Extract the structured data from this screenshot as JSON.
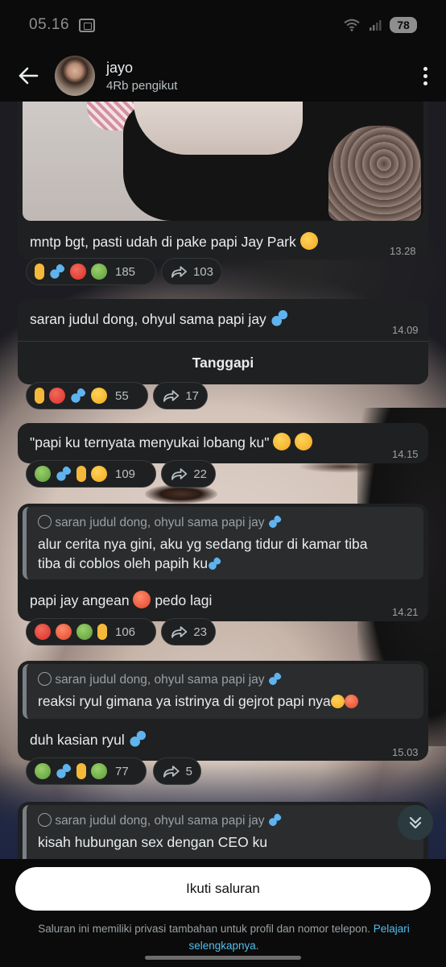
{
  "status_bar": {
    "time": "05.16",
    "battery": "78"
  },
  "header": {
    "channel_name": "jayo",
    "followers": "4Rb pengikut"
  },
  "messages": [
    {
      "text": "mntp bgt, pasti udah di pake papi Jay Park",
      "time": "13.28",
      "reaction_count": "185",
      "forward_count": "103"
    },
    {
      "text": "saran judul dong, ohyul sama papi jay",
      "time": "14.09",
      "reply_label": "Tanggapi",
      "reaction_count": "55",
      "forward_count": "17"
    },
    {
      "text": "\"papi ku ternyata menyukai lobang ku\"",
      "time": "14.15",
      "reaction_count": "109",
      "forward_count": "22"
    },
    {
      "quote_head": "saran judul dong, ohyul sama papi jay",
      "quote_line1": "alur cerita nya gini, aku yg sedang tidur di kamar tiba",
      "quote_line2": "tiba di coblos oleh papih ku",
      "text": "papi jay angean",
      "text_tail": "pedo lagi",
      "time": "14.21",
      "reaction_count": "106",
      "forward_count": "23"
    },
    {
      "quote_head": "saran judul dong, ohyul sama papi jay",
      "quote_line1": "reaksi ryul gimana ya istrinya di gejrot papi nya",
      "text": "duh kasian ryul",
      "time": "15.03",
      "reaction_count": "77",
      "forward_count": "5"
    },
    {
      "quote_head": "saran judul dong, ohyul sama papi jay",
      "quote_line1": "kisah hubungan sex dengan CEO ku"
    }
  ],
  "footer": {
    "follow_label": "Ikuti saluran",
    "privacy_text": "Saluran ini memiliki privasi tambahan untuk profil dan nomor telepon.",
    "learn_more_part1": "Pelajari",
    "learn_more_part2": "selengkapnya",
    "period": "."
  },
  "icons": {
    "point_up": "☝",
    "sweat": "💦",
    "angry": "😡",
    "nauseated": "🤢",
    "hand_over_mouth": "🤭",
    "drooling": "🤤",
    "blush": "☺",
    "sob": "😭",
    "flushed": "😳",
    "vomit": "🤮"
  },
  "colors": {
    "bubble": "#1f2021",
    "link": "#53bdeb",
    "background": "#0b0b0b"
  }
}
